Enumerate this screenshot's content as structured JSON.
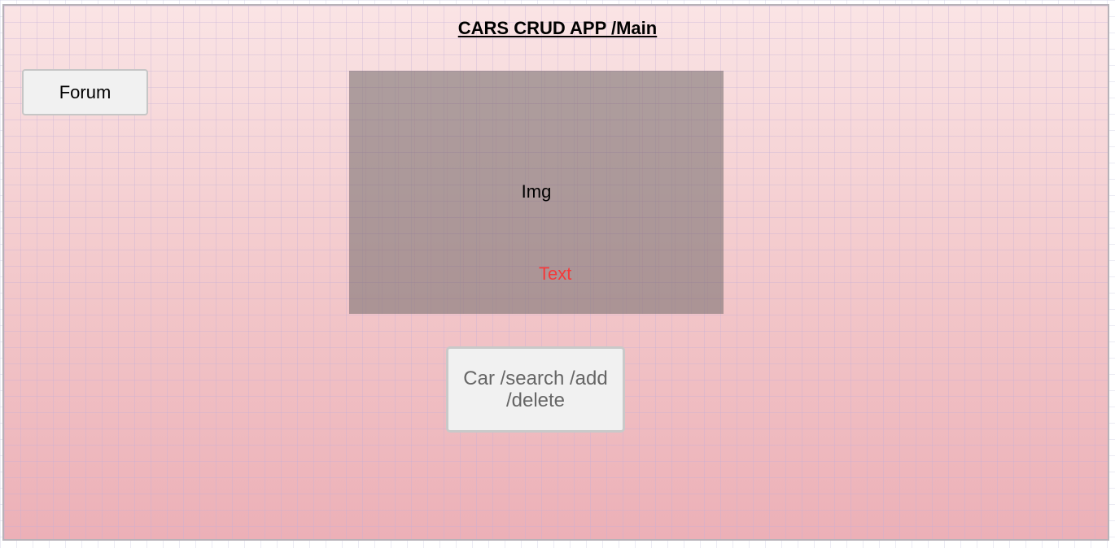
{
  "page": {
    "title": "CARS CRUD APP /Main"
  },
  "nav": {
    "forum_label": "Forum"
  },
  "hero": {
    "image_label": "Img",
    "caption": "Text"
  },
  "actions": {
    "car_label": "Car /search /add /delete"
  },
  "colors": {
    "frame_top": "#fae4e5",
    "frame_bottom": "#ecb0b7",
    "image_placeholder": "#a08f90",
    "caption_text": "#f5393a",
    "button_bg": "#f1f1f1",
    "button_border": "#c6c6c6"
  }
}
